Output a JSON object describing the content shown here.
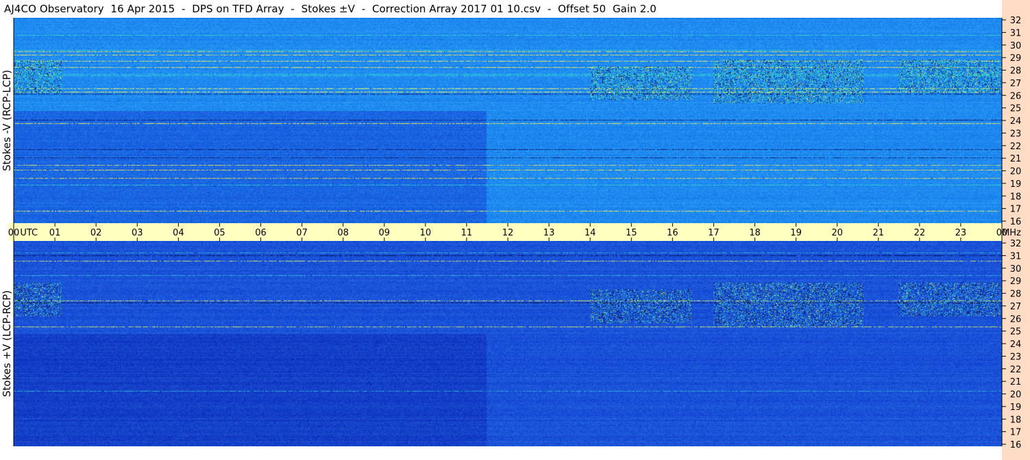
{
  "header": {
    "title": "AJ4CO Observatory  16 Apr 2015  -  DPS on TFD Array  -  Stokes ±V  -  Correction Array 2017 01 10.csv  -  Offset 50  Gain 2.0"
  },
  "chart_data": [
    {
      "type": "heatmap",
      "panel": "top",
      "ylabel": "Stokes -V (RCP-LCP)",
      "x_unit": "UTC",
      "x_ticks": [
        "00",
        "01",
        "02",
        "03",
        "04",
        "05",
        "06",
        "07",
        "08",
        "09",
        "10",
        "11",
        "12",
        "13",
        "14",
        "15",
        "16",
        "17",
        "18",
        "19",
        "20",
        "21",
        "22",
        "23",
        "00"
      ],
      "xlim": [
        0,
        24
      ],
      "y_unit": "MHz",
      "y_ticks": [
        16,
        17,
        18,
        19,
        20,
        21,
        22,
        23,
        24,
        25,
        26,
        27,
        28,
        29,
        30,
        31,
        32
      ],
      "ylim": [
        16,
        32
      ],
      "colors": {
        "base": "#1f8af0",
        "band": "#1a66e2",
        "bright": "#33d2c8",
        "dark": "#0b1a6e",
        "highlight": "#e8e860"
      }
    },
    {
      "type": "heatmap",
      "panel": "bottom",
      "ylabel": "Stokes +V (LCP-RCP)",
      "x_unit": "UTC",
      "x_ticks": [
        "00",
        "01",
        "02",
        "03",
        "04",
        "05",
        "06",
        "07",
        "08",
        "09",
        "10",
        "11",
        "12",
        "13",
        "14",
        "15",
        "16",
        "17",
        "18",
        "19",
        "20",
        "21",
        "22",
        "23",
        "00"
      ],
      "xlim": [
        0,
        24
      ],
      "y_unit": "MHz",
      "y_ticks": [
        16,
        17,
        18,
        19,
        20,
        21,
        22,
        23,
        24,
        25,
        26,
        27,
        28,
        29,
        30,
        31,
        32
      ],
      "ylim": [
        16,
        32
      ],
      "colors": {
        "base": "#1a52d8",
        "band": "#1440c8",
        "bright": "#2fb8d8",
        "dark": "#05104e",
        "highlight": "#c8e070"
      }
    }
  ],
  "colors": {
    "time_axis_bg": "#ffffc0",
    "freq_axis_bg": "#ffdcc4"
  }
}
